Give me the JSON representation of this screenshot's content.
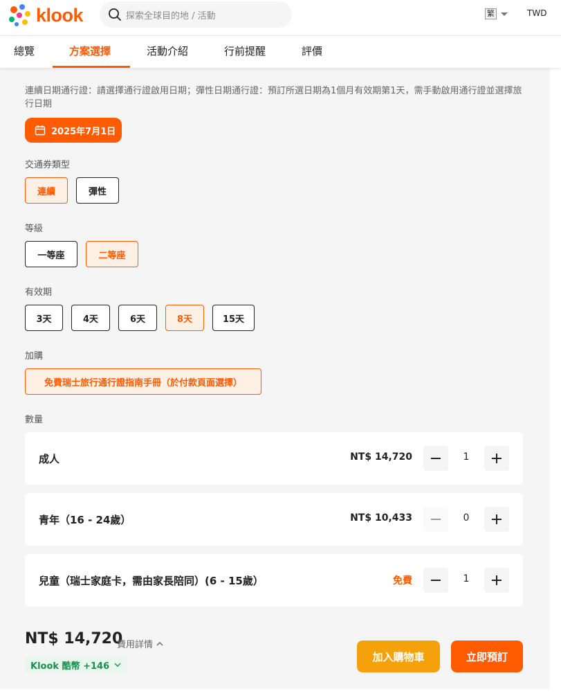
{
  "header": {
    "logo_text": "klook",
    "search_placeholder": "探索全球目的地 / 活動",
    "language": "繁",
    "currency": "TWD"
  },
  "tabs": [
    {
      "label": "總覽"
    },
    {
      "label": "方案選擇"
    },
    {
      "label": "活動介紹"
    },
    {
      "label": "行前提醒"
    },
    {
      "label": "評價"
    }
  ],
  "description": "連續日期通行證：請選擇通行證啟用日期；彈性日期通行證：預訂所選日期為1個月有效期第1天，需手動啟用通行證並選擇旅行日期",
  "date_button": "2025年7月1日",
  "pass_type": {
    "label": "交通券類型",
    "options": [
      "連續",
      "彈性"
    ],
    "selected": "連續"
  },
  "class": {
    "label": "等級",
    "options": [
      "一等座",
      "二等座"
    ],
    "selected": "二等座"
  },
  "validity": {
    "label": "有效期",
    "options": [
      "3天",
      "4天",
      "6天",
      "8天",
      "15天"
    ],
    "selected": "8天"
  },
  "addon": {
    "label": "加購",
    "option": "免費瑞士旅行通行證指南手冊（於付款頁面選擇）"
  },
  "quantity": {
    "label": "數量",
    "rows": [
      {
        "name": "成人",
        "price": "NT$ 14,720",
        "count": "1"
      },
      {
        "name": "青年（16 - 24歲）",
        "price": "NT$ 10,433",
        "count": "0"
      },
      {
        "name": "兒童（瑞士家庭卡，需由家長陪同）(6 - 15歲）",
        "price": "免費",
        "count": "1"
      }
    ]
  },
  "footer": {
    "total": "NT$ 14,720",
    "fee_detail": "費用詳情",
    "coins": "Klook 酷幣 +146",
    "add_to_cart": "加入購物車",
    "book_now": "立即預訂"
  },
  "colors": {
    "brand": "#ff5b00",
    "cart": "#f5a10c",
    "coins_bg": "#e8f6ee",
    "coins_text": "#1a8f4e"
  }
}
